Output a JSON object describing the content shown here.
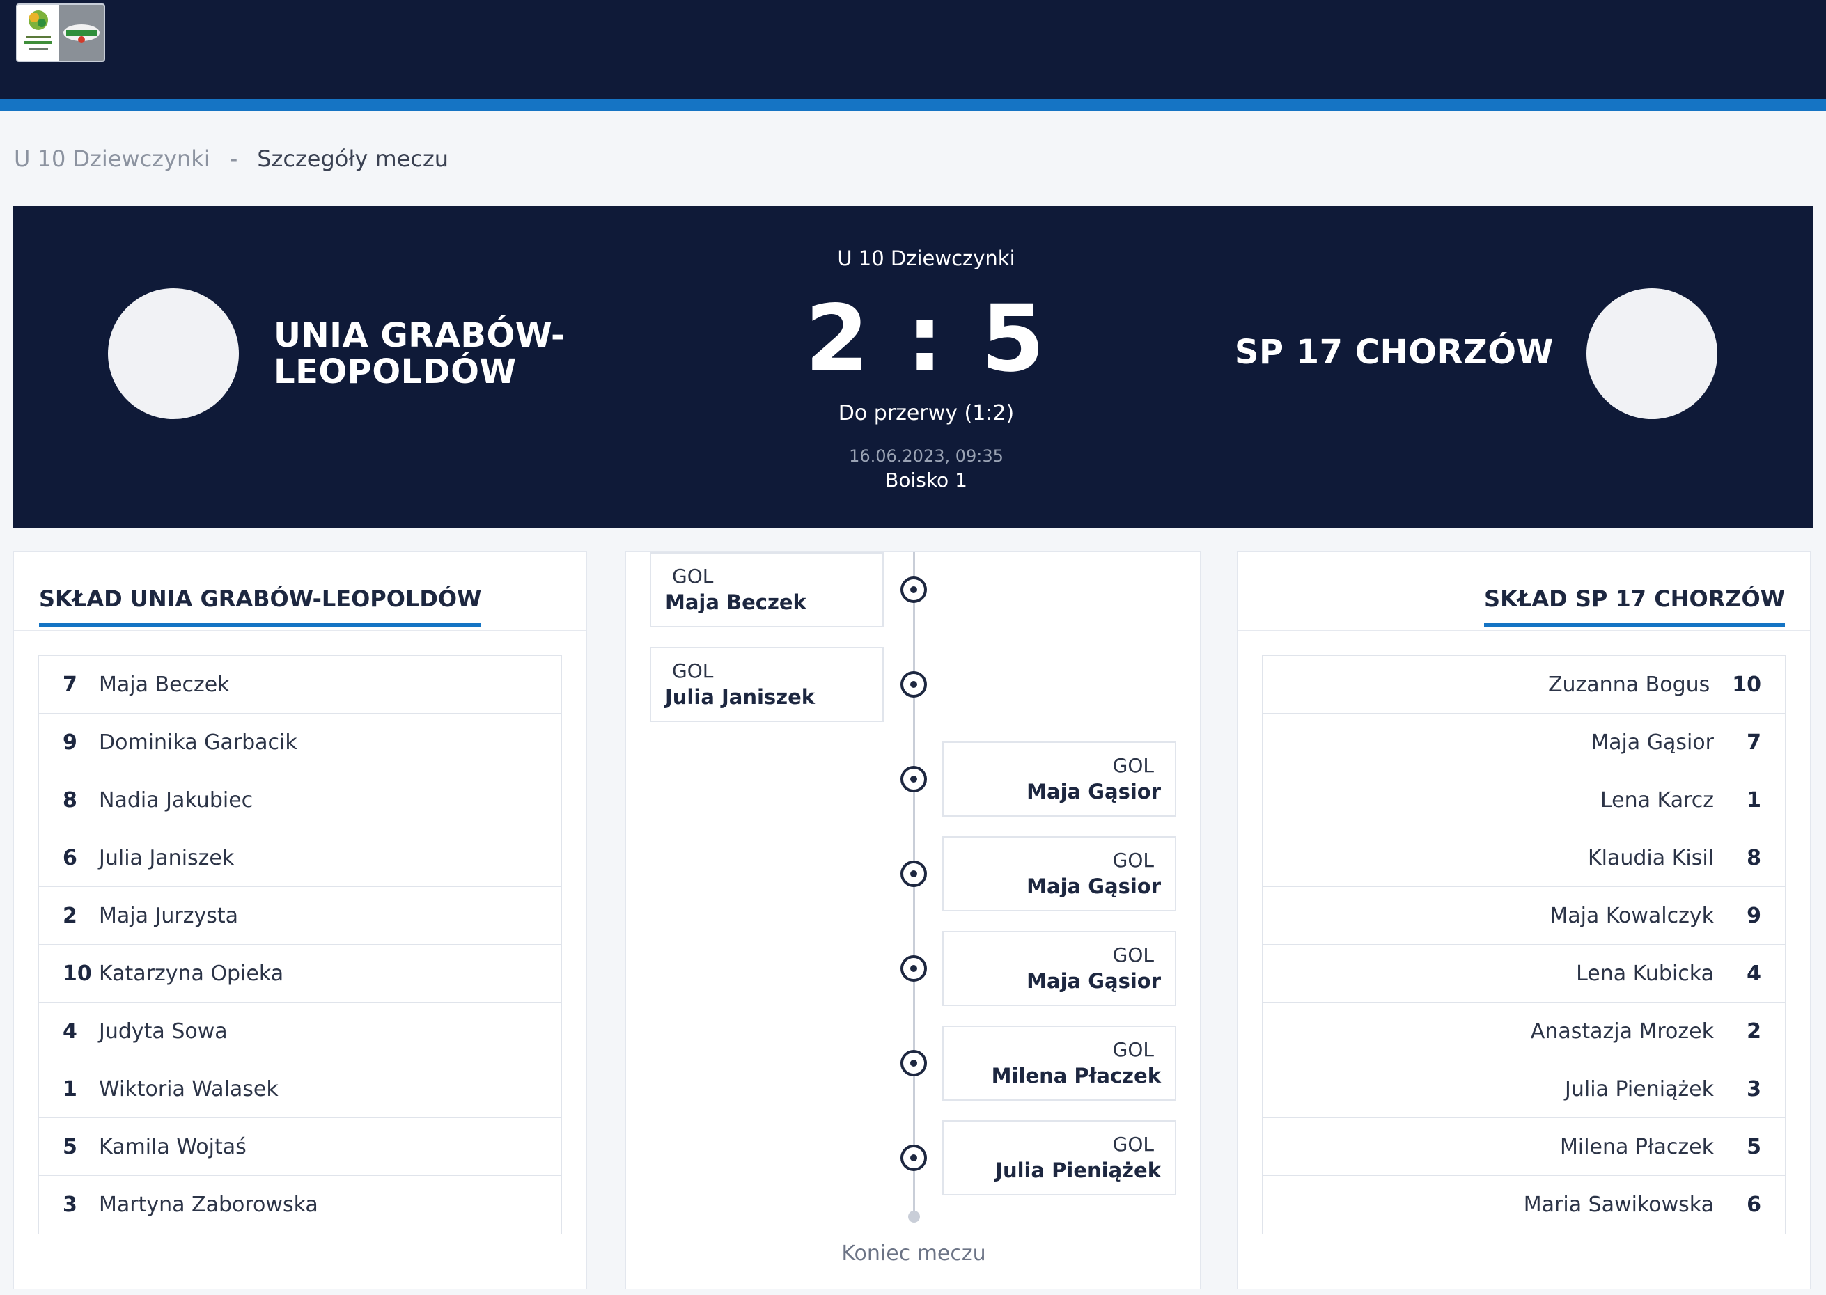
{
  "header": {
    "logos": [
      "tournament-logo-icon",
      "sponsor-logo-icon"
    ]
  },
  "breadcrumb": {
    "category": "U 10 Dziewczynki",
    "separator": "-",
    "current": "Szczegóły meczu"
  },
  "match": {
    "league": "U 10 Dziewczynki",
    "home_team": "UNIA GRABÓW-LEOPOLDÓW",
    "away_team": "SP 17 CHORZÓW",
    "score": "2 : 5",
    "halftime": "Do przerwy (1:2)",
    "datetime": "16.06.2023, 09:35",
    "field": "Boisko 1"
  },
  "home_lineup": {
    "title": "SKŁAD UNIA GRABÓW-LEOPOLDÓW",
    "players": [
      {
        "number": "7",
        "name": "Maja Beczek"
      },
      {
        "number": "9",
        "name": "Dominika Garbacik"
      },
      {
        "number": "8",
        "name": "Nadia Jakubiec"
      },
      {
        "number": "6",
        "name": "Julia Janiszek"
      },
      {
        "number": "2",
        "name": "Maja Jurzysta"
      },
      {
        "number": "10",
        "name": "Katarzyna Opieka"
      },
      {
        "number": "4",
        "name": "Judyta Sowa"
      },
      {
        "number": "1",
        "name": "Wiktoria Walasek"
      },
      {
        "number": "5",
        "name": "Kamila Wojtaś"
      },
      {
        "number": "3",
        "name": "Martyna Zaborowska"
      }
    ]
  },
  "away_lineup": {
    "title": "SKŁAD SP 17 CHORZÓW",
    "players": [
      {
        "number": "10",
        "name": "Zuzanna Bogus"
      },
      {
        "number": "7",
        "name": "Maja Gąsior"
      },
      {
        "number": "1",
        "name": "Lena Karcz"
      },
      {
        "number": "8",
        "name": "Klaudia Kisil"
      },
      {
        "number": "9",
        "name": "Maja Kowalczyk"
      },
      {
        "number": "4",
        "name": "Lena Kubicka"
      },
      {
        "number": "2",
        "name": "Anastazja Mrozek"
      },
      {
        "number": "3",
        "name": "Julia Pieniążek"
      },
      {
        "number": "5",
        "name": "Milena Płaczek"
      },
      {
        "number": "6",
        "name": "Maria Sawikowska"
      }
    ]
  },
  "timeline": {
    "events": [
      {
        "side": "home",
        "type": "GOL",
        "player": "Maja Beczek"
      },
      {
        "side": "home",
        "type": "GOL",
        "player": "Julia Janiszek"
      },
      {
        "side": "away",
        "type": "GOL",
        "player": "Maja Gąsior"
      },
      {
        "side": "away",
        "type": "GOL",
        "player": "Maja Gąsior"
      },
      {
        "side": "away",
        "type": "GOL",
        "player": "Maja Gąsior"
      },
      {
        "side": "away",
        "type": "GOL",
        "player": "Milena Płaczek"
      },
      {
        "side": "away",
        "type": "GOL",
        "player": "Julia Pieniążek"
      }
    ],
    "end_label": "Koniec meczu"
  }
}
